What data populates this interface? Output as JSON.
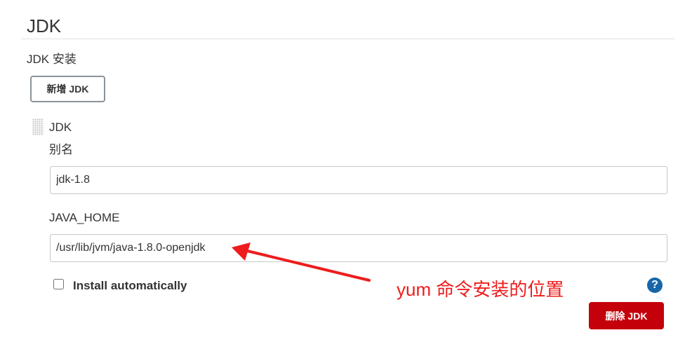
{
  "section": {
    "title": "JDK"
  },
  "installations": {
    "label": "JDK 安装",
    "add_button": "新增 JDK"
  },
  "jdk_item": {
    "title": "JDK",
    "alias_label": "别名",
    "alias_value": "jdk-1.8",
    "java_home_label": "JAVA_HOME",
    "java_home_value": "/usr/lib/jvm/java-1.8.0-openjdk",
    "install_auto_label": "Install automatically",
    "install_auto_checked": false,
    "help_icon": "?",
    "delete_button": "删除 JDK"
  },
  "annotation": {
    "text": "yum 命令安装的位置",
    "color": "#ee1c1c"
  },
  "colors": {
    "delete_button": "#c4000a",
    "help_icon": "#1766a8"
  },
  "icons": {
    "drag_handle": "drag-handle-icon",
    "help": "help-icon"
  }
}
